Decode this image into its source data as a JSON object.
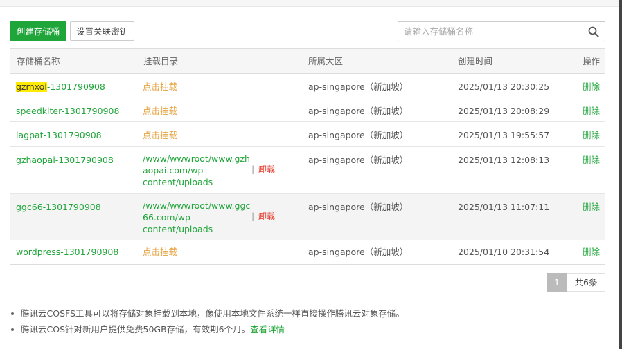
{
  "toolbar": {
    "create_label": "创建存储桶",
    "key_label": "设置关联密钥",
    "search_placeholder": "请输入存储桶名称"
  },
  "table": {
    "headers": {
      "name": "存储桶名称",
      "mount": "挂载目录",
      "region": "所属大区",
      "created": "创建时间",
      "action": "操作"
    },
    "rows": [
      {
        "name_highlight": "gzmxol",
        "name_rest": "-1301790908",
        "mount_action": "点击挂载",
        "region": "ap-singapore（新加坡）",
        "created": "2025/01/13 20:30:25",
        "action": "删除"
      },
      {
        "name": "speedkiter-1301790908",
        "mount_action": "点击挂载",
        "region": "ap-singapore（新加坡）",
        "created": "2025/01/13 20:08:29",
        "action": "删除"
      },
      {
        "name": "lagpat-1301790908",
        "mount_action": "点击挂载",
        "region": "ap-singapore（新加坡）",
        "created": "2025/01/13 19:55:57",
        "action": "删除"
      },
      {
        "name": "gzhaopai-1301790908",
        "mount_path": [
          "/www/wwwroot/www.gzh",
          "aopai.com/wp-",
          "content/uploads"
        ],
        "unmount": "卸载",
        "region": "ap-singapore（新加坡）",
        "created": "2025/01/13 12:08:13",
        "action": "删除"
      },
      {
        "name": "ggc66-1301790908",
        "mount_path": [
          "/www/wwwroot/www.ggc",
          "66.com/wp-",
          "content/uploads"
        ],
        "unmount": "卸载",
        "region": "ap-singapore（新加坡）",
        "created": "2025/01/13 11:07:11",
        "action": "删除"
      },
      {
        "name": "wordpress-1301790908",
        "mount_action": "点击挂载",
        "region": "ap-singapore（新加坡）",
        "created": "2025/01/10 20:31:54",
        "action": "删除"
      }
    ]
  },
  "pagination": {
    "current": "1",
    "total": "共6条"
  },
  "tips": [
    {
      "text": "腾讯云COSFS工具可以将存储对象挂载到本地，像使用本地文件系统一样直接操作腾讯云对象存储。"
    },
    {
      "text": "腾讯云COS针对新用户提供免费50GB存储，有效期6个月。",
      "link": "查看详情"
    }
  ],
  "colors": {
    "accent": "#20a53a",
    "mount_link": "#e6a23c",
    "danger": "#e43b2c",
    "highlight": "#ffeb00"
  },
  "icons": {
    "search": "search-icon"
  }
}
